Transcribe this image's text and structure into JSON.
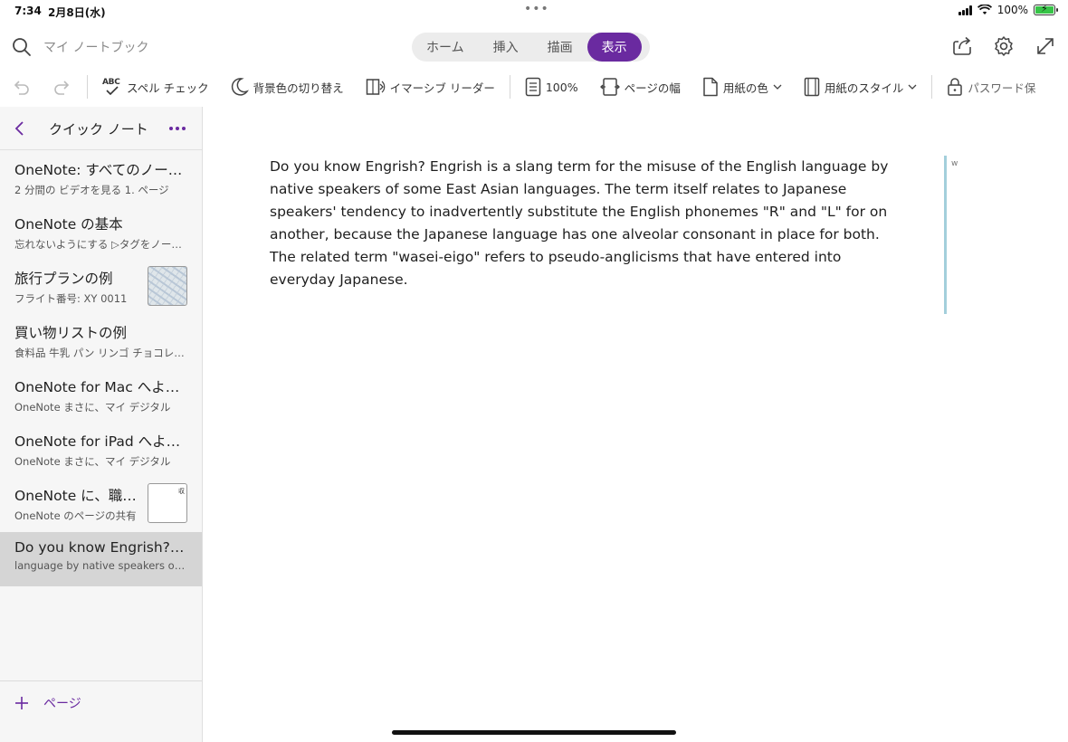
{
  "status": {
    "time": "7:34",
    "date": "2月8日(水)",
    "dots": "•••",
    "battery": "100%"
  },
  "search": {
    "placeholder": "マイ ノートブック"
  },
  "tabs": [
    {
      "label": "ホーム",
      "active": false
    },
    {
      "label": "挿入",
      "active": false
    },
    {
      "label": "描画",
      "active": false
    },
    {
      "label": "表示",
      "active": true
    }
  ],
  "ribbon": {
    "spell_check": "スペル チェック",
    "spell_icon_text": "ABC",
    "bg_toggle": "背景色の切り替え",
    "immersive_reader": "イマーシブ リーダー",
    "zoom": "100%",
    "page_width": "ページの幅",
    "paper_color": "用紙の色",
    "paper_style": "用紙のスタイル",
    "password": "パスワード保"
  },
  "sidebar": {
    "title": "クイック ノート",
    "pages": [
      {
        "title": "OneNote: すべてのノートをひとつの場所に",
        "sub": "2 分間の  ビデオを見る  1. ページ"
      },
      {
        "title": "OneNote の基本",
        "sub": "忘れないようにする  ▷タグをノートに"
      },
      {
        "title": "旅行プランの例",
        "sub": "フライト番号: XY 0011",
        "thumb": "map"
      },
      {
        "title": "買い物リストの例",
        "sub": "食料品  牛乳  パン  リンゴ  チョコレート"
      },
      {
        "title": "OneNote for Mac へようこそ",
        "sub": "OneNote  まさに、マイ デジタル"
      },
      {
        "title": "OneNote for iPad へようこそ",
        "sub": "OneNote  まさに、マイ デジタル"
      },
      {
        "title": "OneNote に、職場や学校の",
        "sub": "OneNote のページの共有",
        "thumb": "doc",
        "thumb_text": "収"
      },
      {
        "title": "Do you know Engrish? Engrish is a slang term",
        "sub": "language by native speakers of some East Asian",
        "selected": true
      }
    ],
    "add_page": "ページ"
  },
  "note": {
    "paragraph1": "Do you know Engrish? Engrish is a slang term for the misuse of the English language by native speakers of some East Asian languages. The term itself relates to Japanese speakers' tendency to inadvertently substitute the English phonemes \"R\" and \"L\" for on another, because the Japanese language has one alveolar consonant in place for both.",
    "paragraph2": "The related term \"wasei-eigo\" refers to pseudo-anglicisms that have entered into everyday Japanese.",
    "side_marker": "w"
  },
  "colors": {
    "accent": "#6a2aa0",
    "battery": "#37c447",
    "note_bar": "#a3cfdb"
  }
}
